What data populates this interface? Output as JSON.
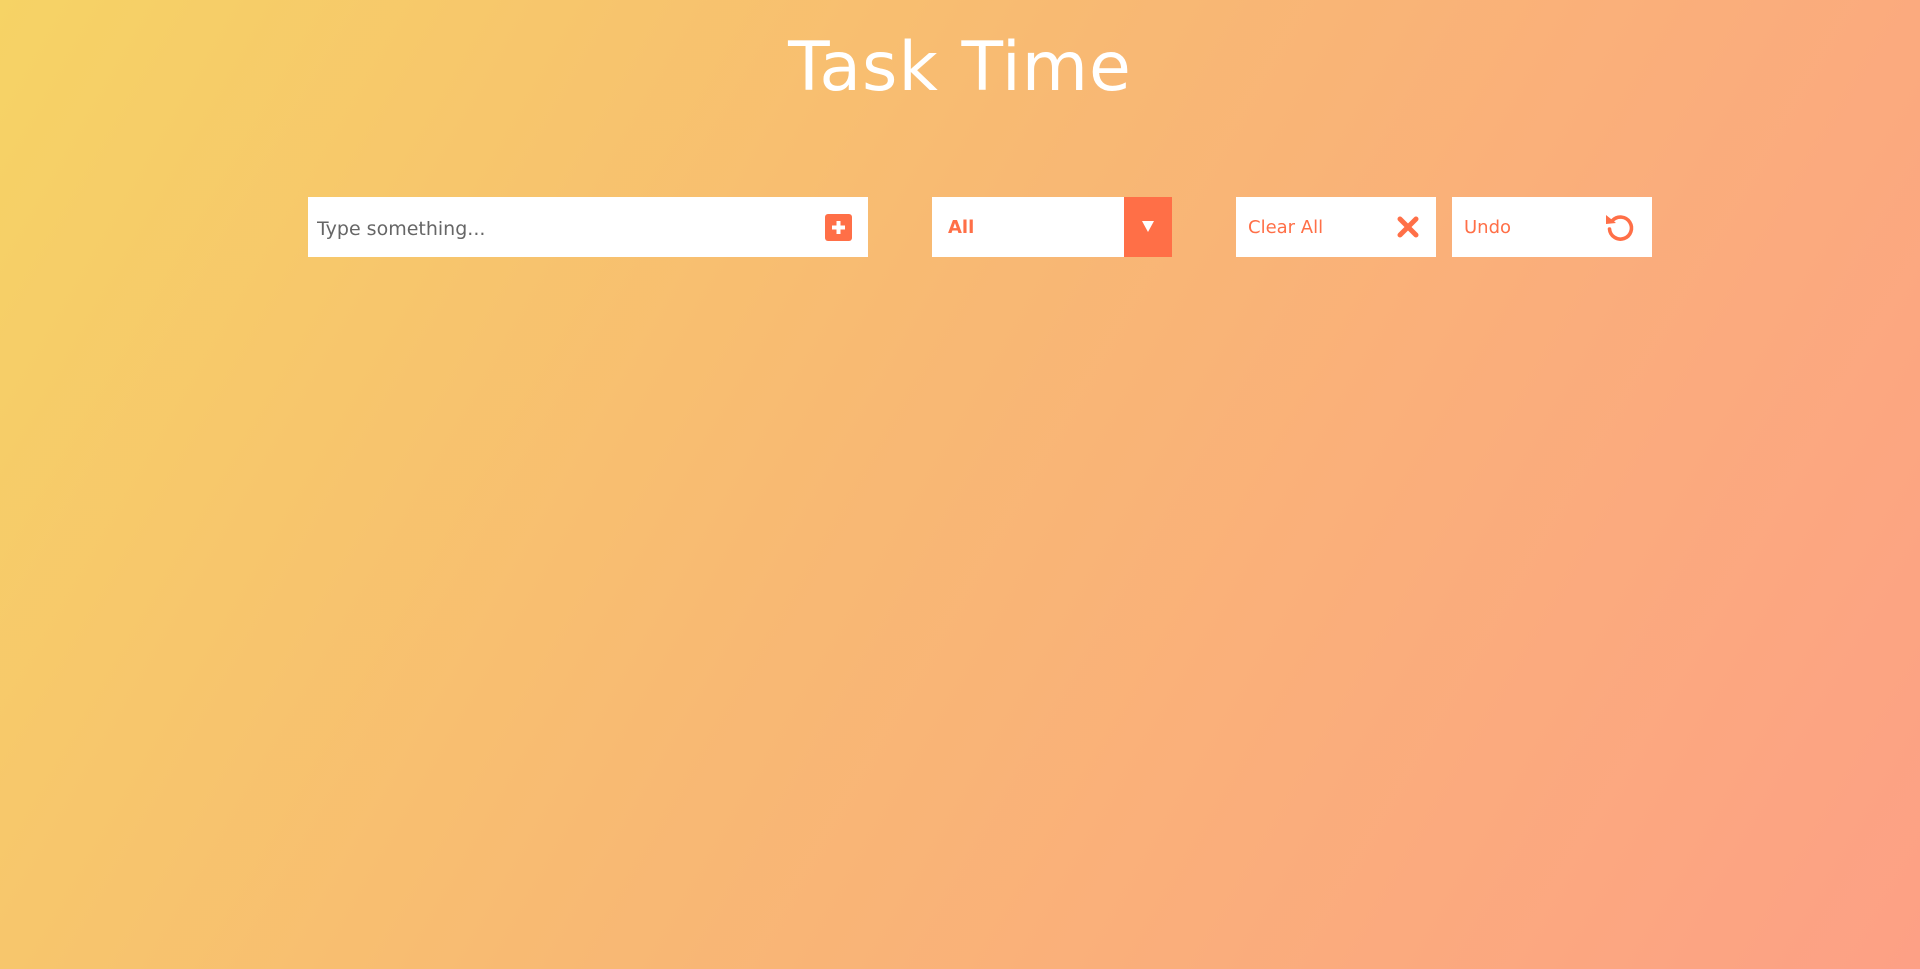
{
  "app": {
    "title": "Task Time"
  },
  "todo_form": {
    "input_placeholder": "Type something...",
    "input_value": "",
    "add_icon": "plus-square-icon"
  },
  "filter": {
    "selected": "All",
    "arrow_icon": "caret-down-icon"
  },
  "actions": {
    "clear_label": "Clear All",
    "clear_icon": "close-icon",
    "undo_label": "Undo",
    "undo_icon": "undo-icon"
  },
  "colors": {
    "accent": "#ff6f47",
    "gradient_start": "#f6d365",
    "gradient_end": "#fda085",
    "surface": "#ffffff"
  }
}
